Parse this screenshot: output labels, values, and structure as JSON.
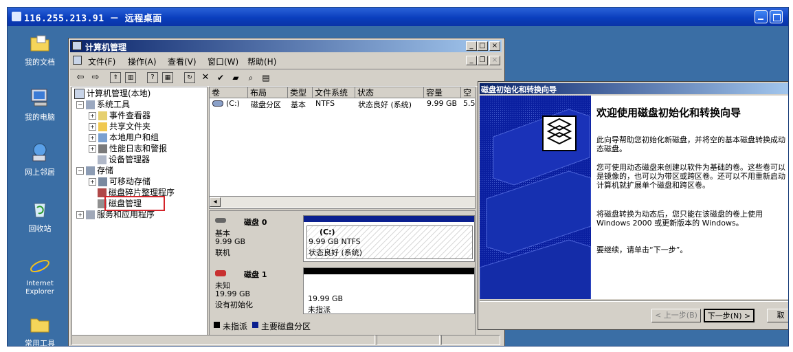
{
  "remote": {
    "title": "116.255.213.91 － 远程桌面"
  },
  "desktop": {
    "icons": [
      {
        "name": "documents",
        "label": "我的文档"
      },
      {
        "name": "computer",
        "label": "我的电脑"
      },
      {
        "name": "network",
        "label": "网上邻居"
      },
      {
        "name": "recycle",
        "label": "回收站"
      },
      {
        "name": "ie",
        "label": "Internet Explorer"
      },
      {
        "name": "tools",
        "label": "常用工具"
      }
    ]
  },
  "cm": {
    "title": "计算机管理",
    "menu": [
      "文件(F)",
      "操作(A)",
      "查看(V)",
      "窗口(W)",
      "帮助(H)"
    ],
    "tree": {
      "root": "计算机管理(本地)",
      "system_tools": "系统工具",
      "event_viewer": "事件查看器",
      "shared_folders": "共享文件夹",
      "local_users": "本地用户和组",
      "perf_logs": "性能日志和警报",
      "device_manager": "设备管理器",
      "storage": "存储",
      "removable": "可移动存储",
      "defrag": "磁盘碎片整理程序",
      "disk_mgmt": "磁盘管理",
      "services": "服务和应用程序"
    },
    "list": {
      "columns": [
        "卷",
        "布局",
        "类型",
        "文件系统",
        "状态",
        "容量",
        "空"
      ],
      "row": {
        "volume": "(C:)",
        "layout": "磁盘分区",
        "type": "基本",
        "fs": "NTFS",
        "status": "状态良好 (系统)",
        "capacity": "9.99 GB",
        "free": "5.5"
      }
    },
    "disks": [
      {
        "name": "磁盘 0",
        "kind": "基本",
        "size": "9.99 GB",
        "state": "联机",
        "vol_name": "(C:)",
        "vol_info": "9.99 GB NTFS",
        "vol_status": "状态良好 (系统)"
      },
      {
        "name": "磁盘 1",
        "kind": "未知",
        "size": "19.99 GB",
        "state": "没有初始化",
        "vol_info": "19.99 GB",
        "vol_status": "未指派"
      }
    ],
    "legend": {
      "unallocated": "未指派",
      "primary": "主要磁盘分区"
    }
  },
  "wizard": {
    "title": "磁盘初始化和转换向导",
    "heading": "欢迎使用磁盘初始化和转换向导",
    "p1": "此向导帮助您初始化新磁盘，并将空的基本磁盘转换成动态磁盘。",
    "p2": "您可使用动态磁盘来创建以软件为基础的卷。这些卷可以是镜像的，也可以为带区或跨区卷。还可以不用重新启动计算机就扩展单个磁盘和跨区卷。",
    "p3": "将磁盘转换为动态后，您只能在该磁盘的卷上使用 Windows 2000 或更新版本的 Windows。",
    "p4": "要继续，请单击“下一步”。",
    "back": "< 上一步(B)",
    "next": "下一步(N) >",
    "cancel": "取"
  }
}
